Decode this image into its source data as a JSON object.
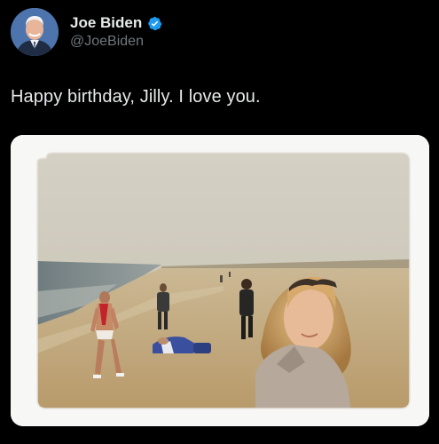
{
  "author": {
    "display_name": "Joe Biden",
    "handle": "@JoeBiden",
    "verified": true,
    "avatar_icon": "avatar-photo",
    "verified_icon": "verified-badge-icon",
    "verified_color": "#1d9bf0"
  },
  "tweet": {
    "text": "Happy birthday, Jilly. I love you."
  },
  "media": {
    "kind": "photo",
    "frame_color": "#fafafa"
  },
  "colors": {
    "background": "#000000",
    "primary_text": "#e7e9ea",
    "secondary_text": "#71767b"
  }
}
